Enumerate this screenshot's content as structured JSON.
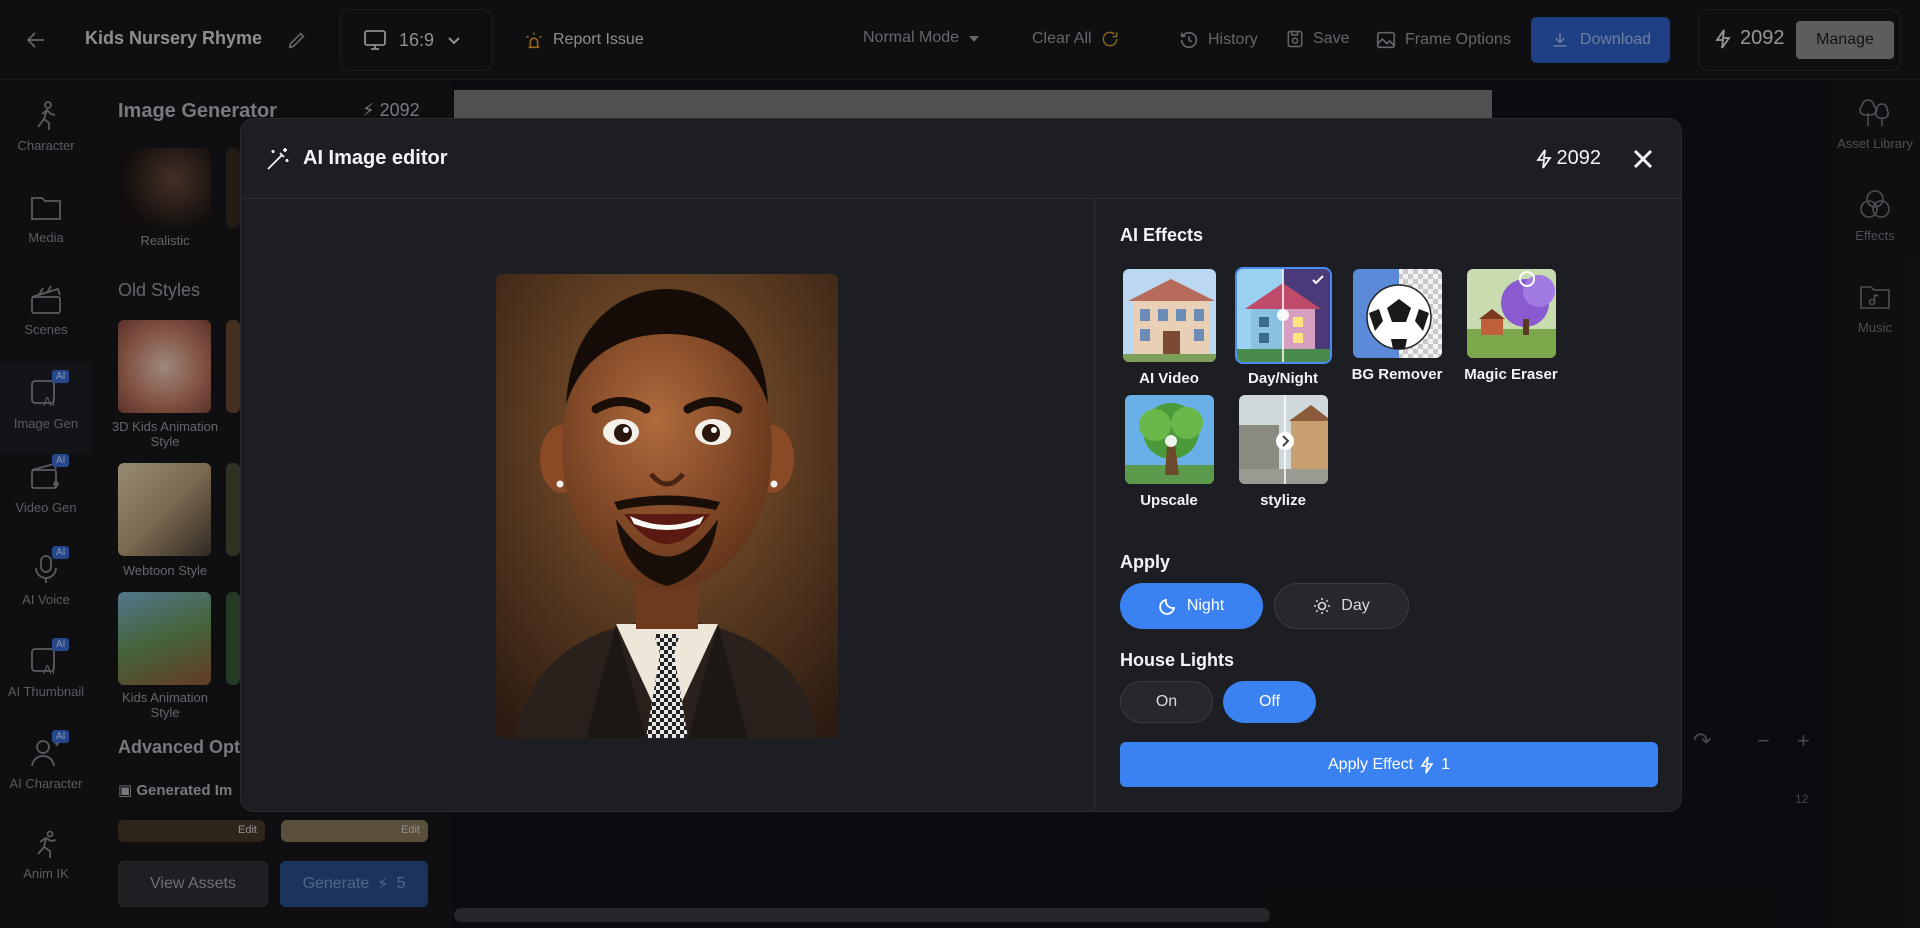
{
  "header": {
    "project_title": "Kids Nursery Rhyme",
    "aspect_ratio": "16:9",
    "report_issue": "Report Issue",
    "mode": "Normal Mode",
    "clear_all": "Clear All",
    "history": "History",
    "save": "Save",
    "frame_options": "Frame Options",
    "download": "Download",
    "credits": "2092",
    "manage": "Manage"
  },
  "left_rail": {
    "items": [
      {
        "label": "Character",
        "badge": ""
      },
      {
        "label": "Media",
        "badge": ""
      },
      {
        "label": "Scenes",
        "badge": ""
      },
      {
        "label": "Image Gen",
        "badge": "AI"
      },
      {
        "label": "Video Gen",
        "badge": "AI"
      },
      {
        "label": "AI Voice",
        "badge": "AI"
      },
      {
        "label": "AI Thumbnail",
        "badge": "AI"
      },
      {
        "label": "AI Character",
        "badge": "AI"
      },
      {
        "label": "Anim IK",
        "badge": ""
      }
    ]
  },
  "panel": {
    "title": "Image Generator",
    "credits": "2092",
    "realistic_label": "Realistic",
    "old_styles_heading": "Old Styles",
    "styles": [
      "3D Kids Animation Style",
      "Webtoon Style",
      "Kids Animation Style"
    ],
    "advanced_options": "Advanced Opt",
    "generated_images": "Generated Im",
    "edit_label": "Edit",
    "view_assets": "View Assets",
    "generate": "Generate",
    "generate_cost": "5"
  },
  "right_rail": {
    "items": [
      "Asset Library",
      "Effects",
      "Music"
    ]
  },
  "timeline": {
    "ruler_mark": "12"
  },
  "modal": {
    "title": "AI Image editor",
    "credits": "2092",
    "ai_effects_heading": "AI Effects",
    "effects": [
      {
        "label": "AI Video",
        "selected": false
      },
      {
        "label": "Day/Night",
        "selected": true
      },
      {
        "label": "BG Remover",
        "selected": false
      },
      {
        "label": "Magic Eraser",
        "selected": false
      },
      {
        "label": "Upscale",
        "selected": false
      },
      {
        "label": "stylize",
        "selected": false
      }
    ],
    "apply_heading": "Apply",
    "apply_options": [
      {
        "label": "Night",
        "active": true
      },
      {
        "label": "Day",
        "active": false
      }
    ],
    "house_lights_heading": "House Lights",
    "house_lights_options": [
      {
        "label": "On",
        "active": false
      },
      {
        "label": "Off",
        "active": true
      }
    ],
    "apply_effect_button": "Apply Effect",
    "apply_effect_cost": "1"
  },
  "colors": {
    "accent": "#3a82f2",
    "modal_bg": "#1d1e23",
    "page_bg": "#121317"
  }
}
